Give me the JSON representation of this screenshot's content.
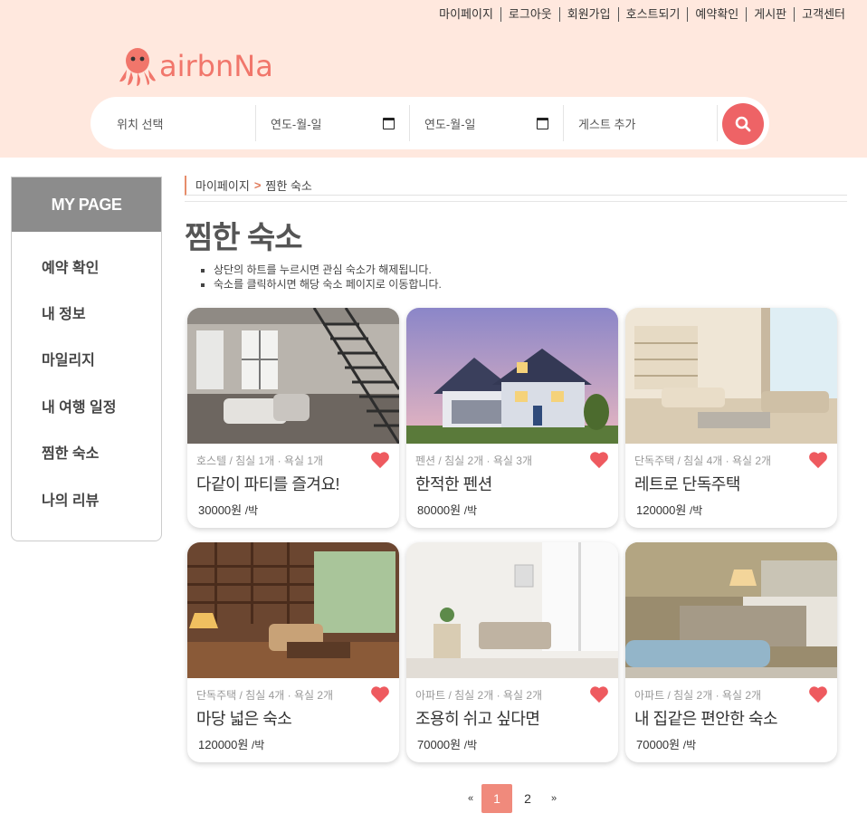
{
  "topnav": [
    "마이페이지",
    "로그아웃",
    "회원가입",
    "호스트되기",
    "예약확인",
    "게시판",
    "고객센터"
  ],
  "logo": {
    "text": "airbnNa",
    "brand_color": "#f1766b"
  },
  "search": {
    "location_placeholder": "위치 선택",
    "checkin_placeholder": "연도-월-일",
    "checkout_placeholder": "연도-월-일",
    "guest_placeholder": "게스트 추가",
    "button_color": "#ee6366"
  },
  "sidebar": {
    "title": "MY PAGE",
    "items": [
      {
        "label": "예약 확인"
      },
      {
        "label": "내 정보"
      },
      {
        "label": "마일리지"
      },
      {
        "label": "내 여행 일정"
      },
      {
        "label": "찜한 숙소"
      },
      {
        "label": "나의 리뷰"
      }
    ]
  },
  "breadcrumb": {
    "parent": "마이페이지",
    "separator": ">",
    "current": "찜한 숙소"
  },
  "page": {
    "title": "찜한 숙소",
    "notes": [
      "상단의 하트를 누르시면 관심 숙소가 해제됩니다.",
      "숙소를 클릭하시면 해당 숙소 페이지로 이동합니다."
    ]
  },
  "cards": [
    {
      "meta": "호스텔 / 침실 1개 · 욕실 1개",
      "title": "다같이 파티를 즐겨요!",
      "price": "30000원",
      "unit": "/박",
      "scene": "loft"
    },
    {
      "meta": "펜션 / 침실 2개 · 욕실 3개",
      "title": "한적한 펜션",
      "price": "80000원",
      "unit": "/박",
      "scene": "house"
    },
    {
      "meta": "단독주택 / 침실 4개 · 욕실 2개",
      "title": "레트로 단독주택",
      "price": "120000원",
      "unit": "/박",
      "scene": "living"
    },
    {
      "meta": "단독주택 / 침실 4개 · 욕실 2개",
      "title": "마당 넓은 숙소",
      "price": "120000원",
      "unit": "/박",
      "scene": "library"
    },
    {
      "meta": "아파트 / 침실 2개 · 욕실 2개",
      "title": "조용히 쉬고 싶다면",
      "price": "70000원",
      "unit": "/박",
      "scene": "white"
    },
    {
      "meta": "아파트 / 침실 2개 · 욕실 2개",
      "title": "내 집같은 편안한 숙소",
      "price": "70000원",
      "unit": "/박",
      "scene": "bedroom"
    }
  ],
  "pagination": {
    "prev": "«",
    "pages": [
      "1",
      "2"
    ],
    "current": "1",
    "next": "»"
  },
  "colors": {
    "header_bg": "#ffe8de",
    "heart": "#ee5a5f",
    "sidebar_head": "#8c8c8c",
    "pager_active": "#f08a7c"
  }
}
